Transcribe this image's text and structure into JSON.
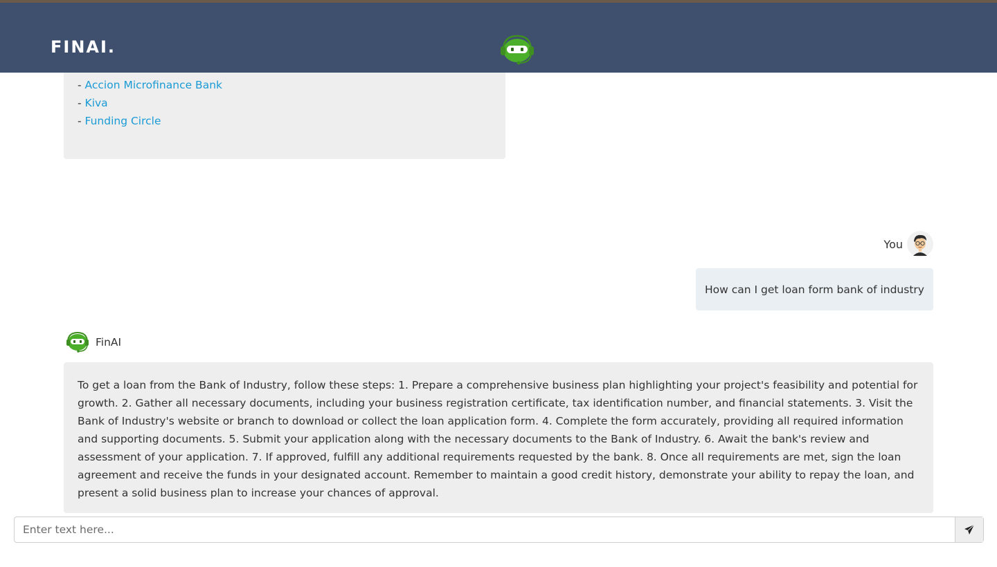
{
  "header": {
    "brand": "FINAI."
  },
  "chat": {
    "previous_message": {
      "links": [
        "Accion Microfinance Bank",
        "Kiva",
        "Funding Circle"
      ]
    },
    "user": {
      "name": "You",
      "message": "How can I get loan form bank of industry"
    },
    "bot": {
      "name": "FinAI",
      "message": "To get a loan from the Bank of Industry, follow these steps: 1. Prepare a comprehensive business plan highlighting your project's feasibility and potential for growth. 2. Gather all necessary documents, including your business registration certificate, tax identification number, and financial statements. 3. Visit the Bank of Industry's website or branch to download or collect the loan application form. 4. Complete the form accurately, providing all required information and supporting documents. 5. Submit your application along with the necessary documents to the Bank of Industry. 6. Await the bank's review and assessment of your application. 7. If approved, fulfill any additional requirements requested by the bank. 8. Once all requirements are met, sign the loan agreement and receive the funds in your designated account. Remember to maintain a good credit history, demonstrate your ability to repay the loan, and present a solid business plan to increase your chances of approval."
    }
  },
  "input": {
    "placeholder": "Enter text here...",
    "value": ""
  },
  "icons": {
    "header_bot": "robot-headset-icon",
    "user_avatar": "user-avatar-icon",
    "bot_avatar": "robot-headset-icon",
    "send": "paper-plane-icon"
  },
  "colors": {
    "header_bg": "#3f506e",
    "bot_green": "#4caf2a",
    "link": "#1a9bd6",
    "bubble_grey": "#eeeeee",
    "bubble_user": "#e9eff2"
  }
}
